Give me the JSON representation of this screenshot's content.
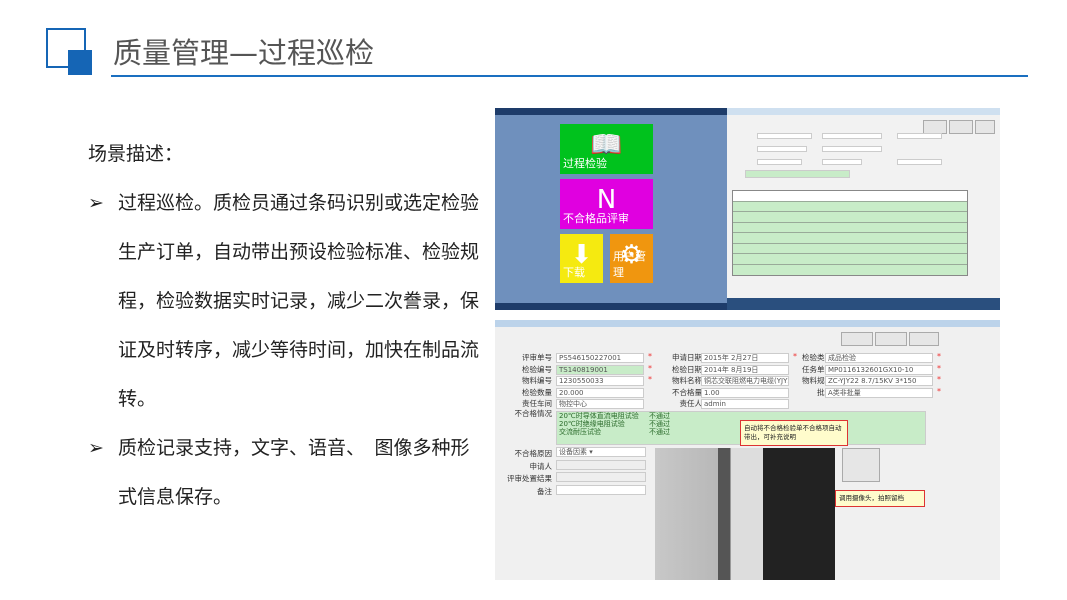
{
  "slide": {
    "title": "质量管理—过程巡检",
    "scene_label": "场景描述：",
    "bullets": [
      "过程巡检。质检员通过条码识别或选定检验生产订单，自动带出预设检验标准、检验规程，检验数据实时记录，减少二次誊录，保证及时转序，减少等待时间，加快在制品流转。",
      "质检记录支持，文字、语音、　图像多种形式信息保存。"
    ],
    "accent": "#1565b5"
  },
  "menu_screen": {
    "tiles": [
      {
        "label": "过程检验",
        "color": "#00c21d",
        "icon": "book-icon"
      },
      {
        "label": "不合格品评审",
        "color": "#e000e0",
        "icon": "onenote-icon"
      },
      {
        "label": "下载",
        "color": "#f5ea10",
        "icon": "arrow-down-icon"
      },
      {
        "label": "用户管理",
        "color": "#f0960f",
        "icon": "gear-icon"
      }
    ]
  },
  "review_form": {
    "fields": [
      {
        "label": "评审单号",
        "value": "PS546150227001"
      },
      {
        "label": "检验编号",
        "value": "TS140819001"
      },
      {
        "label": "物料编号",
        "value": "1230550033"
      },
      {
        "label": "检验数量",
        "value": "20.000"
      },
      {
        "label": "责任车间",
        "value": "物控中心"
      },
      {
        "label": "申请日期",
        "value": "2015年 2月27日"
      },
      {
        "label": "检验日期",
        "value": "2014年 8月19日"
      },
      {
        "label": "物料名称",
        "value": "铜芯交联阻燃电力电缆(YJY22-"
      },
      {
        "label": "不合格量",
        "value": "1.00"
      },
      {
        "label": "责任人",
        "value": "admin"
      },
      {
        "label": "检验类型",
        "value": "成品检验"
      },
      {
        "label": "任务单号",
        "value": "MP0116132601GX10-10"
      },
      {
        "label": "物料规格",
        "value": "ZC-YJY22 8.7/15KV 3*150"
      },
      {
        "label": "批量",
        "value": "A类非批量"
      }
    ],
    "defect_label": "不合格情况",
    "defects": [
      {
        "item": "20℃时导体直流电阻试验",
        "result": "不通过"
      },
      {
        "item": "20℃时绝缘电阻试验",
        "result": "不通过"
      },
      {
        "item": "交流耐压试验",
        "result": "不通过"
      }
    ],
    "reason_label": "不合格原因",
    "reason_value": "设备因素",
    "applicant_label": "申请人",
    "result_label": "评审处置结果",
    "remark_label": "备注",
    "note1": "自动将不合格检验单不合格项自动带出，可补充说明",
    "note2": "调用摄像头，拍照留档"
  }
}
